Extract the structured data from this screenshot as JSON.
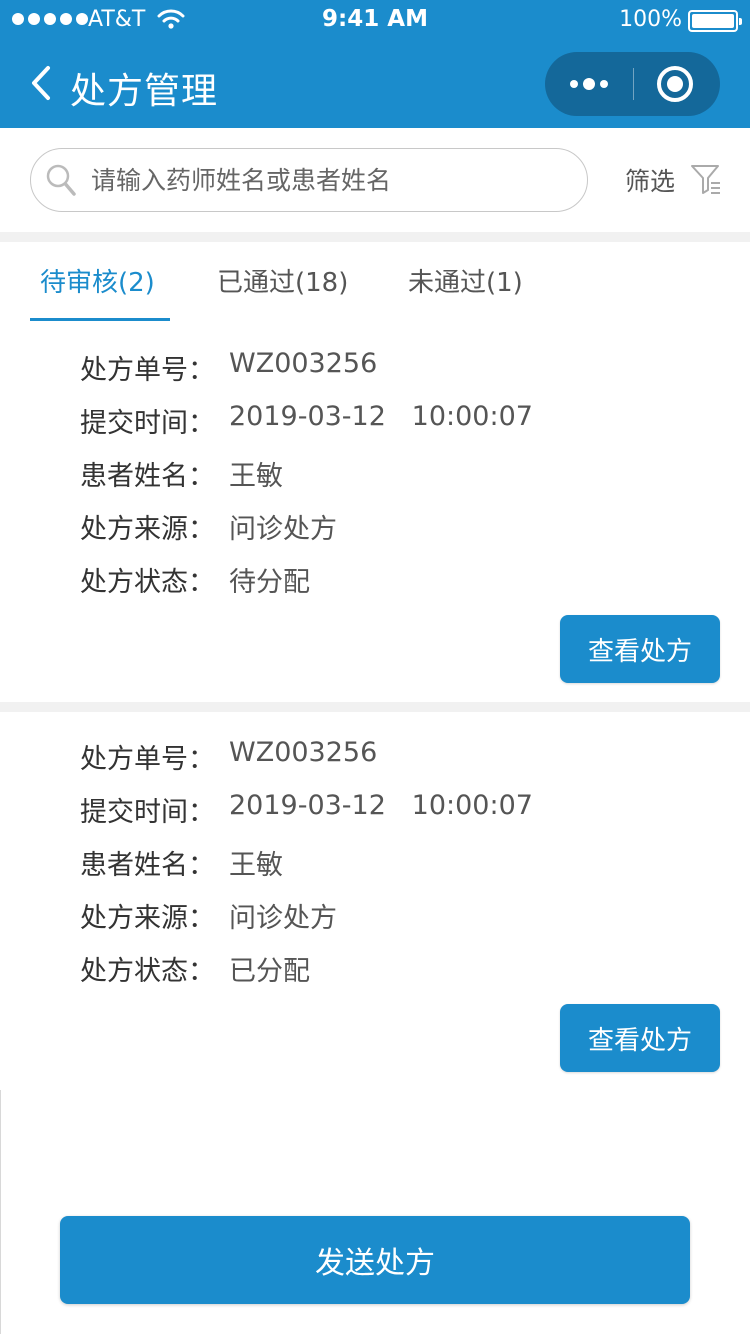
{
  "status_bar": {
    "carrier": "AT&T",
    "time": "9:41 AM",
    "battery": "100%"
  },
  "nav": {
    "title": "处方管理"
  },
  "search": {
    "placeholder": "请输入药师姓名或患者姓名",
    "value": "",
    "filter_label": "筛选"
  },
  "tabs": [
    {
      "label": "待审核(2)",
      "active": true
    },
    {
      "label": "已通过(18)",
      "active": false
    },
    {
      "label": "未通过(1)",
      "active": false
    }
  ],
  "labels": {
    "rx_no": "处方单号：",
    "submit_time": "提交时间：",
    "patient": "患者姓名：",
    "source": "处方来源：",
    "status": "处方状态："
  },
  "prescriptions": [
    {
      "rx_no": "WZ003256",
      "submit_time": "2019-03-12   10:00:07",
      "patient": "王敏",
      "source": "问诊处方",
      "status": "待分配",
      "button": "查看处方"
    },
    {
      "rx_no": "WZ003256",
      "submit_time": "2019-03-12   10:00:07",
      "patient": "王敏",
      "source": "问诊处方",
      "status": "已分配",
      "button": "查看处方"
    }
  ],
  "send_button": "发送处方",
  "colors": {
    "primary": "#1b8ccc",
    "capsule": "#14689a",
    "divider": "#f1f1f1"
  }
}
